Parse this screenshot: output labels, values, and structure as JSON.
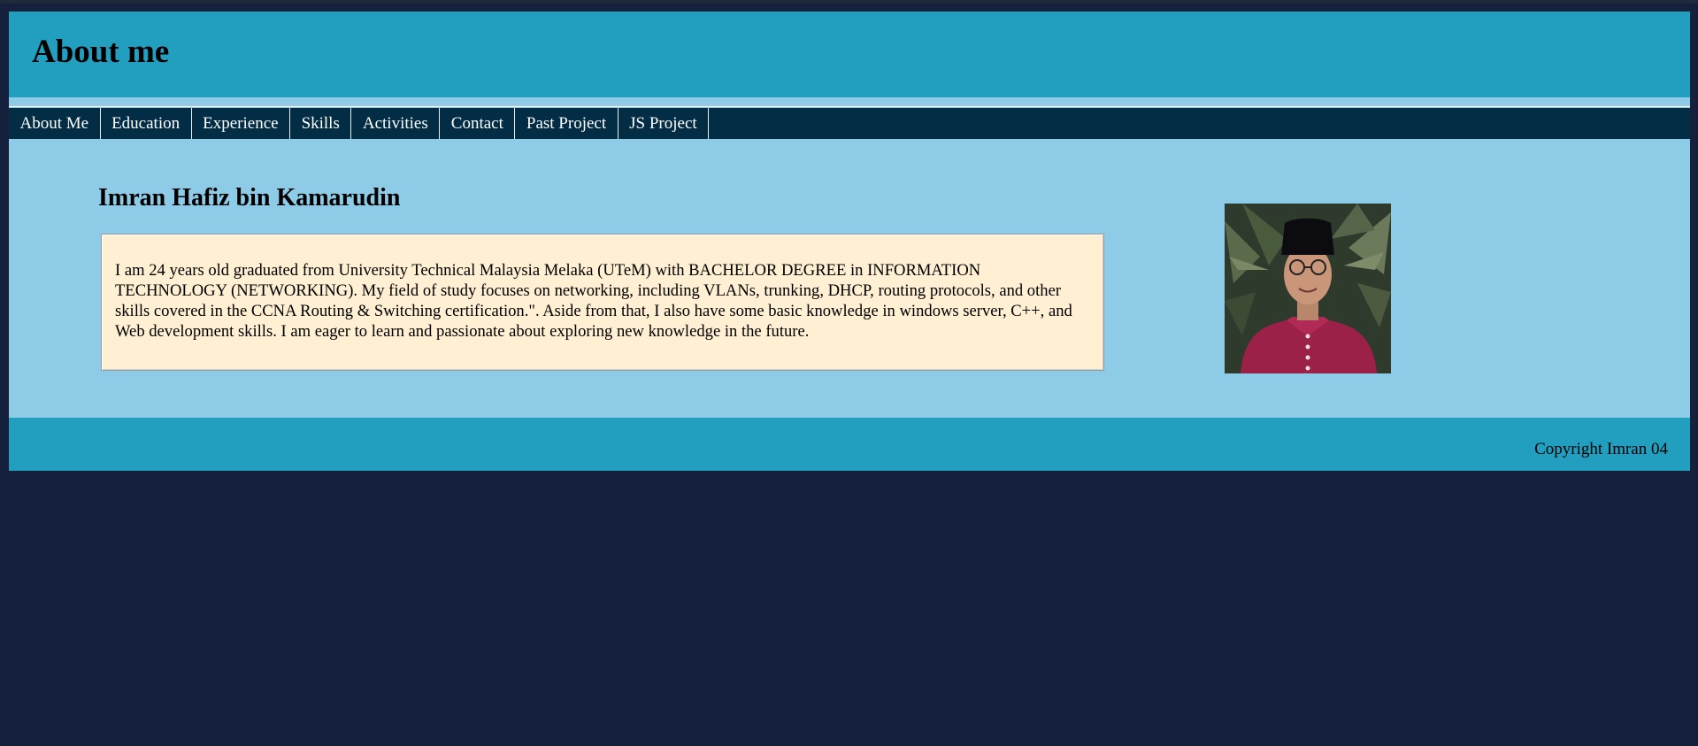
{
  "header": {
    "title": "About me"
  },
  "nav": {
    "items": [
      {
        "label": "About Me"
      },
      {
        "label": "Education"
      },
      {
        "label": "Experience"
      },
      {
        "label": "Skills"
      },
      {
        "label": "Activities"
      },
      {
        "label": "Contact"
      },
      {
        "label": "Past Project"
      },
      {
        "label": "JS Project"
      }
    ]
  },
  "profile": {
    "name": "Imran Hafiz bin Kamarudin",
    "bio": "I am 24 years old graduated from University Technical Malaysia Melaka (UTeM) with BACHELOR DEGREE in INFORMATION TECHNOLOGY (NETWORKING). My field of study focuses on networking, including VLANs, trunking, DHCP, routing protocols, and other skills covered in the CCNA Routing & Switching certification.\". Aside from that, I also have some basic knowledge in windows server, C++, and Web development skills. I am eager to learn and passionate about exploring new knowledge in the future."
  },
  "footer": {
    "copyright": "Copyright Imran 04"
  },
  "colors": {
    "background": "#14203c",
    "header": "#229ebe",
    "nav": "#022d45",
    "content": "#8ecbe6",
    "bio_box": "#fff0d4"
  }
}
